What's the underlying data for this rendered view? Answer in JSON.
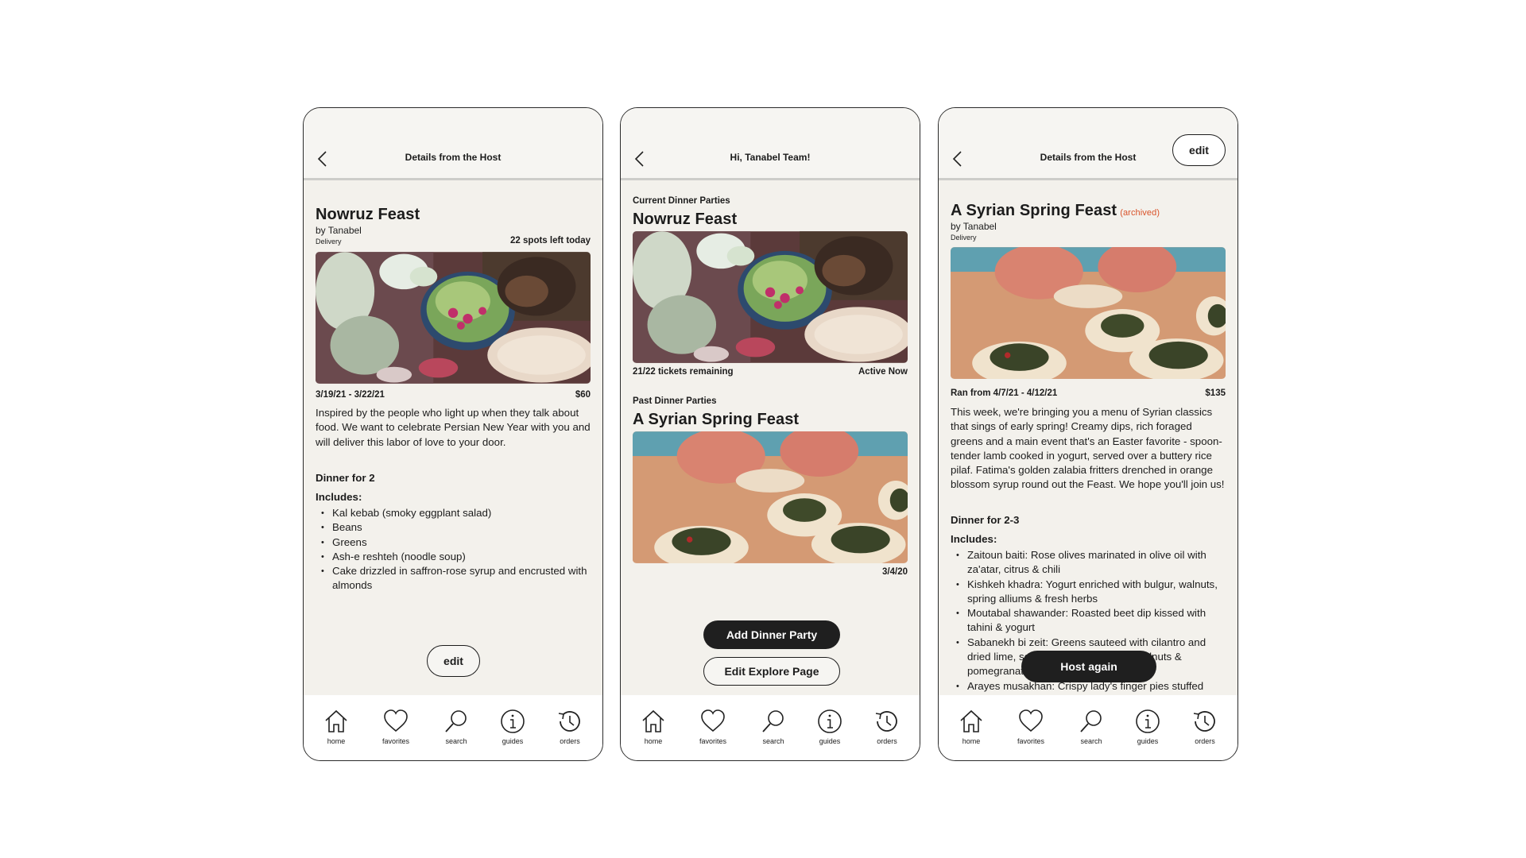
{
  "colors": {
    "background": "#f3f1ec",
    "accent_archived": "#d9532a",
    "dark_button": "#1f1f1f"
  },
  "nav": [
    {
      "label": "home",
      "icon": "home-icon"
    },
    {
      "label": "favorites",
      "icon": "heart-icon"
    },
    {
      "label": "search",
      "icon": "search-icon"
    },
    {
      "label": "guides",
      "icon": "info-icon"
    },
    {
      "label": "orders",
      "icon": "history-icon"
    }
  ],
  "screen1": {
    "header_title": "Details from the Host",
    "title": "Nowruz Feast",
    "byline": "by Tanabel",
    "delivery": "Delivery",
    "spots": "22 spots left today",
    "dates": "3/19/21 - 3/22/21",
    "price": "$60",
    "description": "Inspired by the people who light up when they talk about food. We want to celebrate Persian New Year with you and will deliver this labor of love to your door.",
    "serving": "Dinner for 2",
    "includes_label": "Includes:",
    "includes": [
      "Kal kebab (smoky eggplant salad)",
      "Beans",
      "Greens",
      "Ash-e reshteh (noodle soup)",
      "Cake drizzled in saffron-rose syrup and encrusted with almonds"
    ],
    "edit_label": "edit"
  },
  "screen2": {
    "header_title": "Hi, Tanabel Team!",
    "current_label": "Current Dinner Parties",
    "current_title": "Nowruz Feast",
    "tickets": "21/22 tickets remaining",
    "status": "Active Now",
    "past_label": "Past Dinner Parties",
    "past_title": "A Syrian Spring Feast",
    "past_date": "3/4/20",
    "add_button": "Add Dinner Party",
    "edit_explore_button": "Edit Explore Page"
  },
  "screen3": {
    "header_title": "Details from the Host",
    "edit_label": "edit",
    "title": "A Syrian Spring Feast",
    "archived": "(archived)",
    "byline": "by Tanabel",
    "delivery": "Delivery",
    "dates": "Ran from 4/7/21 - 4/12/21",
    "price": "$135",
    "description": "This week, we're bringing you a menu of Syrian classics that sings of early spring! Creamy dips, rich foraged greens and a main event that's an Easter favorite - spoon-tender lamb cooked in yogurt, served over a buttery rice pilaf. Fatima's golden zalabia fritters drenched in orange blossom syrup round out the Feast. We hope you'll join us!",
    "serving": "Dinner for 2-3",
    "includes_label": "Includes:",
    "includes": [
      "Zaitoun baiti: Rose olives marinated in olive oil with za'atar, citrus & chili",
      "Kishkeh khadra: Yogurt enriched with bulgur, walnuts, spring alliums & fresh herbs",
      "Moutabal shawander: Roasted beet dip kissed with tahini & yogurt",
      "Sabanekh bi zeit: Greens sauteed with cilantro and dried lime, served with fried onions, walnuts & pomegranate seeds",
      "Arayes musakhan: Crispy lady's finger pies stuffed"
    ],
    "host_again": "Host again"
  }
}
